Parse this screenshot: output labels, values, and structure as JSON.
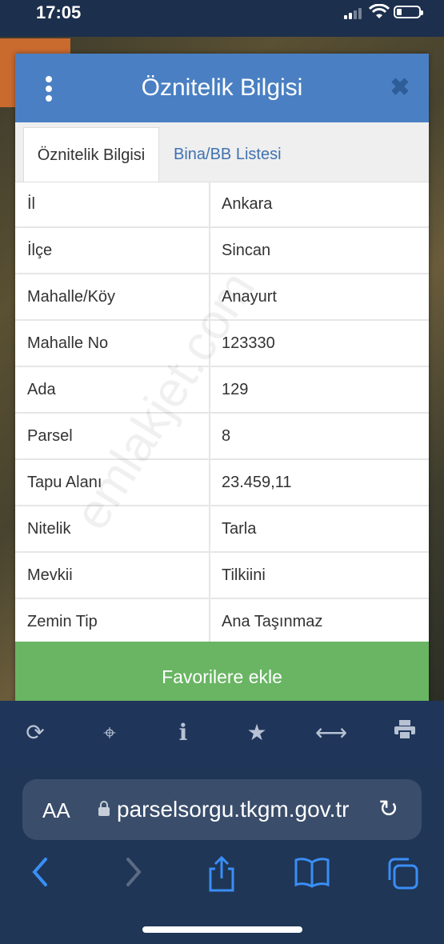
{
  "status": {
    "time": "17:05"
  },
  "modal": {
    "title": "Öznitelik Bilgisi",
    "tabs": [
      {
        "label": "Öznitelik Bilgisi",
        "active": true
      },
      {
        "label": "Bina/BB Listesi",
        "active": false
      }
    ],
    "rows": [
      {
        "key": "İl",
        "value": "Ankara"
      },
      {
        "key": "İlçe",
        "value": "Sincan"
      },
      {
        "key": "Mahalle/Köy",
        "value": "Anayurt"
      },
      {
        "key": "Mahalle No",
        "value": "123330"
      },
      {
        "key": "Ada",
        "value": "129"
      },
      {
        "key": "Parsel",
        "value": "8"
      },
      {
        "key": "Tapu Alanı",
        "value": "23.459,11"
      },
      {
        "key": "Nitelik",
        "value": "Tarla"
      },
      {
        "key": "Mevkii",
        "value": "Tilkiini"
      },
      {
        "key": "Zemin Tip",
        "value": "Ana Taşınmaz"
      }
    ],
    "favorite_label": "Favorilere ekle"
  },
  "watermark": "emlakjet.com",
  "toolbar": {
    "icons": [
      "refresh-icon",
      "crosshair-icon",
      "info-icon",
      "star-icon",
      "arrows-horizontal-icon",
      "print-icon"
    ]
  },
  "browser": {
    "text_size_label": "AA",
    "url": "parselsorgu.tkgm.gov.tr"
  },
  "colors": {
    "header_blue": "#4a80c3",
    "favorite_green": "#69b563",
    "tab_link_blue": "#3f72b0",
    "safari_blue": "#3a8ef6"
  }
}
